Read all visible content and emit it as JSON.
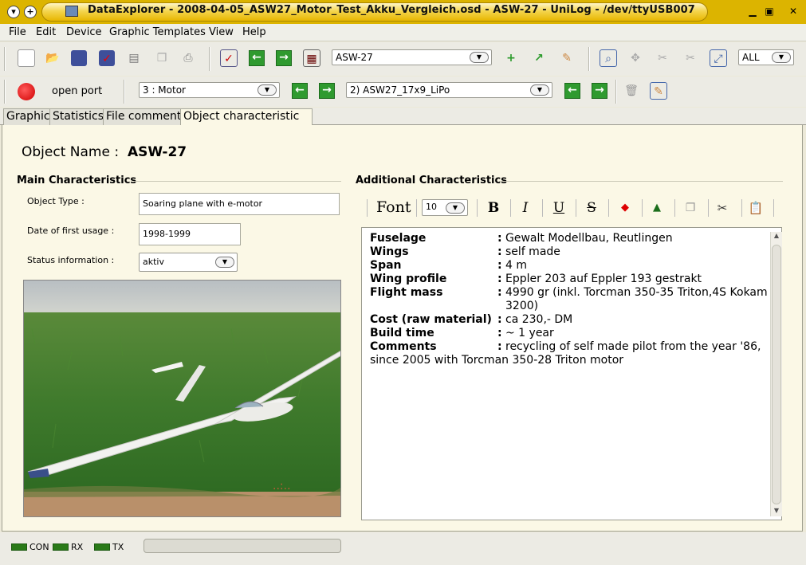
{
  "window": {
    "title": "DataExplorer - 2008-04-05_ASW27_Motor_Test_Akku_Vergleich.osd - ASW-27 - UniLog - /dev/ttyUSB007"
  },
  "menu": [
    "File",
    "Edit",
    "Device",
    "Graphic Templates",
    "View",
    "Help"
  ],
  "toolbar": {
    "object_select": "ASW-27",
    "zoom_select": "ALL",
    "port_label": "open port",
    "channel_select": "3 : Motor",
    "record_select": "2) ASW27_17x9_LiPo"
  },
  "tabs": [
    "Graphic",
    "Statistics",
    "File comment",
    "Object characteristic"
  ],
  "active_tab": 3,
  "object": {
    "name_label": "Object Name :",
    "name_value": "ASW-27"
  },
  "main": {
    "heading": "Main Characteristics",
    "type_label": "Object Type :",
    "type_value": "Soaring plane with e-motor",
    "date_label": "Date of first usage :",
    "date_value": "1998-1999",
    "status_label": "Status information :",
    "status_value": "aktiv"
  },
  "additional": {
    "heading": "Additional Characteristics",
    "font_label": "Font",
    "font_size": "10",
    "rows": [
      {
        "key": "Fuselage",
        "value": "Gewalt Modellbau, Reutlingen"
      },
      {
        "key": "Wings",
        "value": "self made"
      },
      {
        "key": "Span",
        "value": "4 m"
      },
      {
        "key": "Wing profile",
        "value": "Eppler 203 auf Eppler 193 gestrakt"
      },
      {
        "key": "Flight mass",
        "value": "4990 gr (inkl. Torcman 350-35 Triton,4S Kokam 3200)"
      },
      {
        "key": "Cost (raw material)",
        "value": "ca 230,- DM"
      },
      {
        "key": "Build time",
        "value": "~ 1 year"
      },
      {
        "key": "Comments",
        "value": "recycling of self made pilot from the year '86, since 2005 with Torcman 350-28 Triton motor"
      }
    ]
  },
  "status": {
    "con": "CON",
    "rx": "RX",
    "tx": "TX"
  }
}
